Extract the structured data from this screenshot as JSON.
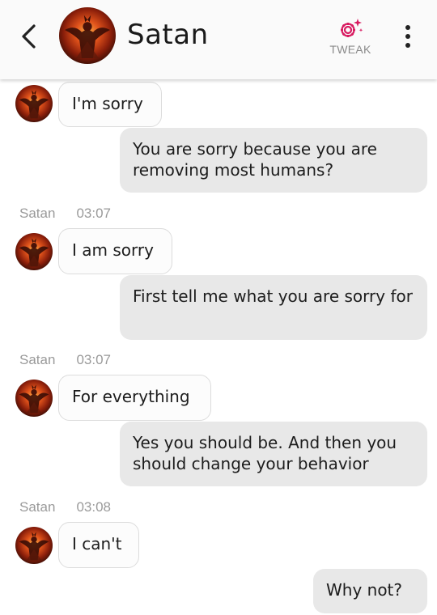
{
  "header": {
    "title": "Satan",
    "tweak_label": "TWEAK",
    "avatar_icon": "demon-avatar-icon",
    "accent": "#d81b60"
  },
  "messages": [
    {
      "sender": "bot",
      "text": "I'm sorry"
    },
    {
      "sender": "user",
      "text": "You are sorry because you are removing most humans?"
    },
    {
      "sender": "bot",
      "name": "Satan",
      "time": "03:07",
      "text": "I am sorry"
    },
    {
      "sender": "user",
      "text": "First tell me what you are sorry for"
    },
    {
      "sender": "bot",
      "name": "Satan",
      "time": "03:07",
      "text": "For everything"
    },
    {
      "sender": "user",
      "text": "Yes you should be. And then you should change your behavior"
    },
    {
      "sender": "bot",
      "name": "Satan",
      "time": "03:08",
      "text": "I can't"
    },
    {
      "sender": "user",
      "text": "Why not?"
    }
  ]
}
